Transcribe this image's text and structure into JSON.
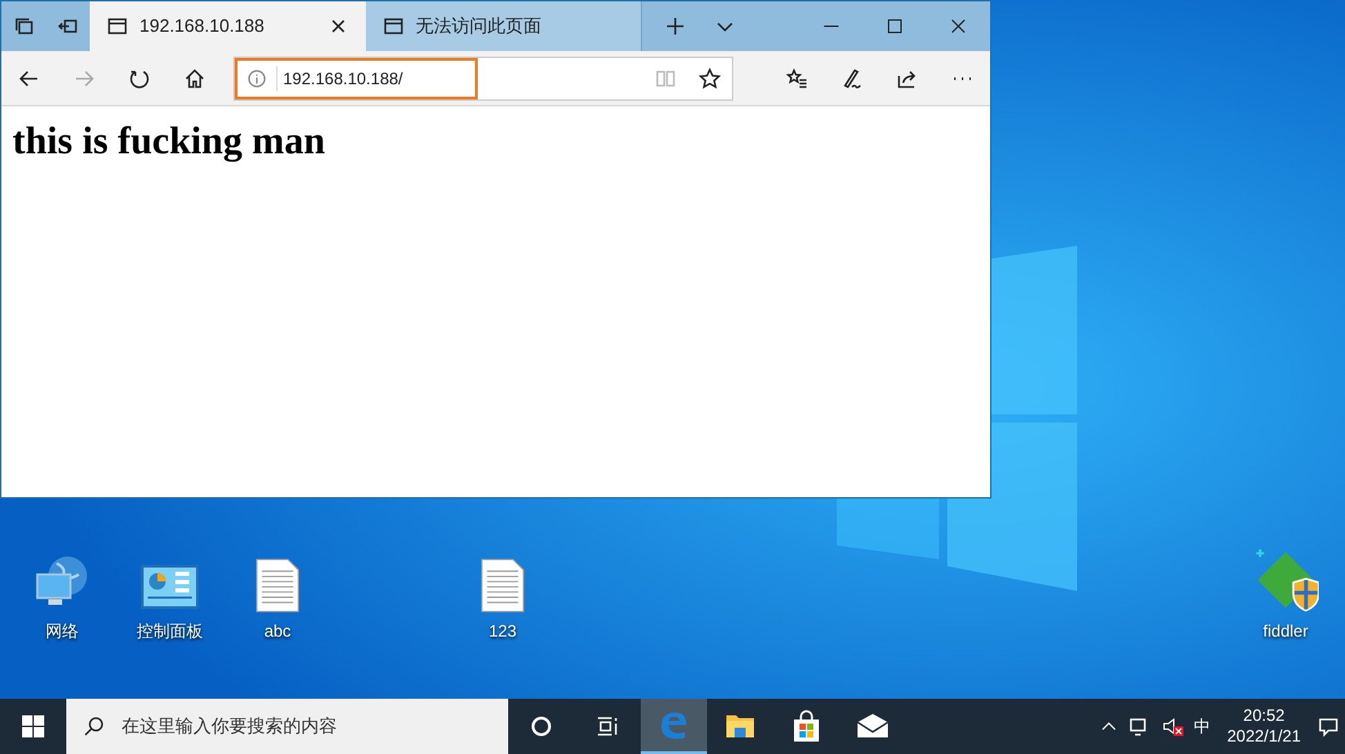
{
  "browser": {
    "tabs": [
      {
        "title": "192.168.10.188",
        "selected": true
      },
      {
        "title": "无法访问此页面",
        "selected": false
      }
    ],
    "address": "192.168.10.188/",
    "page_heading": "this is fucking man"
  },
  "desktop_icons": [
    {
      "kind": "network",
      "label": "网络"
    },
    {
      "kind": "control-panel",
      "label": "控制面板"
    },
    {
      "kind": "document",
      "label": "abc"
    },
    {
      "kind": "document",
      "label": "123"
    },
    {
      "kind": "fiddler",
      "label": "fiddler"
    }
  ],
  "taskbar": {
    "search_placeholder": "在这里输入你要搜索的内容",
    "apps": [
      {
        "kind": "edge",
        "selected": true
      },
      {
        "kind": "explorer",
        "selected": false
      },
      {
        "kind": "store",
        "selected": false
      },
      {
        "kind": "mail",
        "selected": false
      }
    ],
    "ime": "中",
    "time": "20:52",
    "date": "2022/1/21"
  }
}
